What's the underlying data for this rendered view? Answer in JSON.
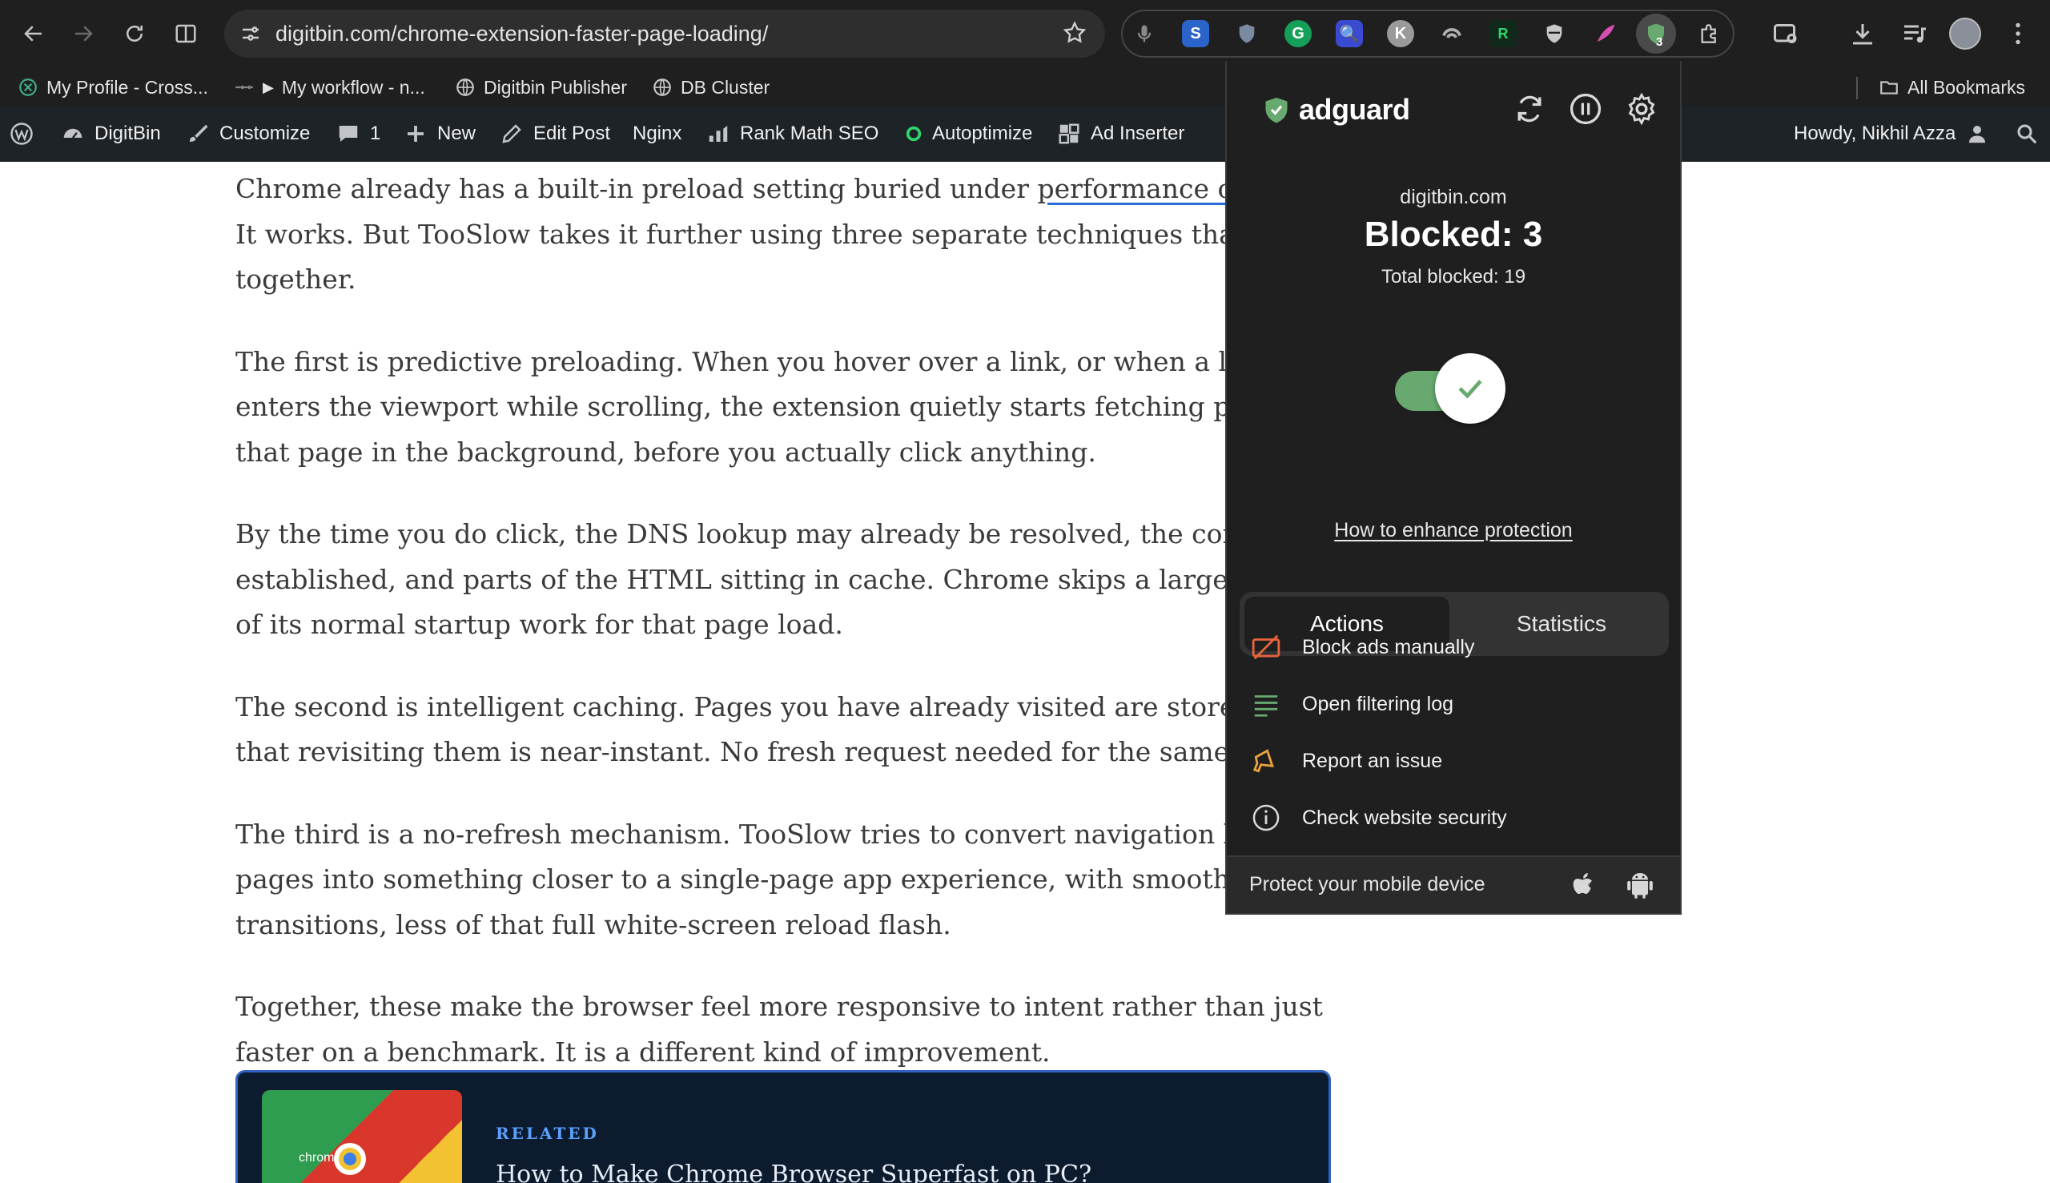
{
  "browser": {
    "url": "digitbin.com/chrome-extension-faster-page-loading/",
    "extension_badge": "3",
    "bookmarks": [
      "My Profile - Cross...",
      "My workflow - n...",
      "Digitbin Publisher",
      "DB Cluster"
    ],
    "all_bookmarks": "All Bookmarks"
  },
  "wpbar": {
    "site": "DigitBin",
    "customize": "Customize",
    "comments": "1",
    "new": "New",
    "edit_post": "Edit Post",
    "nginx": "Nginx",
    "rank_math": "Rank Math SEO",
    "autoptimize": "Autoptimize",
    "ad_inserter": "Ad Inserter",
    "howdy": "Howdy, Nikhil Azza"
  },
  "article": {
    "p1_before": "Chrome already has a built-in preload setting buried under ",
    "p1_link": "performance options",
    "p1_after": ". It works. But TooSlow takes it further using three separate techniques that work together.",
    "p2": "The first is predictive preloading. When you hover over a link, or when a link enters the viewport while scrolling, the extension quietly starts fetching parts of that page in the background, before you actually click anything.",
    "p3": "By the time you do click, the DNS lookup may already be resolved, the connection established, and parts of the HTML sitting in cache. Chrome skips a large chunk of its normal startup work for that page load.",
    "p4": "The second is intelligent caching. Pages you have already visited are stored so that revisiting them is near-instant. No fresh request needed for the same content.",
    "p5": "The third is a no-refresh mechanism. TooSlow tries to convert navigation between pages into something closer to a single-page app experience, with smoother transitions, less of that full white-screen reload flash.",
    "p6": "Together, these make the browser feel more responsive to intent rather than just faster on a benchmark. It is a different kind of improvement."
  },
  "related": {
    "kicker": "RELATED",
    "title": "How to Make Chrome Browser Superfast on PC?",
    "thumb_word": "chrome"
  },
  "popup": {
    "brand": "adguard",
    "domain": "digitbin.com",
    "blocked": "Blocked: 3",
    "total": "Total blocked: 19",
    "protection_enabled": true,
    "enhance_link": "How to enhance protection",
    "tabs": [
      "Actions",
      "Statistics"
    ],
    "actions": [
      "Block ads manually",
      "Open filtering log",
      "Report an issue",
      "Check website security"
    ],
    "footer": "Protect your mobile device",
    "accent_color": "#67a96f"
  }
}
